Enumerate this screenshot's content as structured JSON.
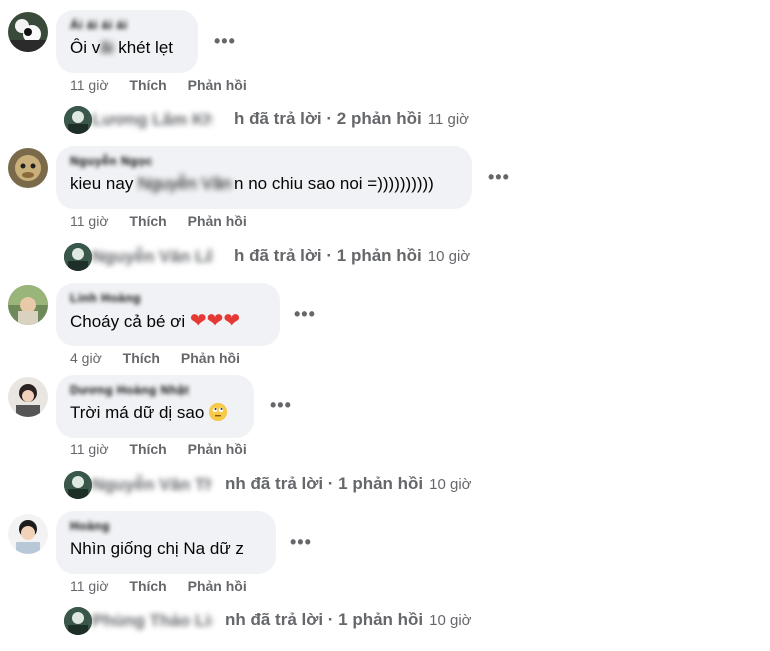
{
  "actions": {
    "like": "Thích",
    "reply": "Phản hồi"
  },
  "more_icon": "•••",
  "comments": [
    {
      "author": "Ái ái ái ái",
      "text_a": "Ôi v",
      "text_hidden": "ãi",
      "text_b": " khét lẹt",
      "time": "11 giờ",
      "reply_summary": {
        "name": "Lương Lâm Khánh",
        "suffix": "h đã trả lời · 2 phản hồi",
        "time": "11 giờ"
      }
    },
    {
      "author": "Nguyễn Ngọc",
      "text_a": "kieu nay ",
      "text_hidden": "Nguyễn Văn",
      "text_b": "n no chiu sao noi =))))))))))",
      "time": "11 giờ",
      "reply_summary": {
        "name": "Nguyễn Văn Lâm",
        "suffix": "h đã trả lời · 1 phản hồi",
        "time": "10 giờ"
      }
    },
    {
      "author": "Linh Hoàng",
      "text": "Choáy cả bé ơi",
      "hearts": "❤❤❤",
      "time": "4 giờ"
    },
    {
      "author": "Dương Hoàng Nhật",
      "text": "Trời má dữ dị sao",
      "emoji": "face-with-rolling-eyes",
      "time": "11 giờ",
      "reply_summary": {
        "name": "Nguyễn Văn Thanh",
        "suffix": "nh đã trả lời · 1 phản hồi",
        "time": "10 giờ"
      }
    },
    {
      "author": "Hoàng",
      "text": "Nhìn giống chị Na dữ z",
      "time": "11 giờ",
      "reply_summary": {
        "name": "Phùng Thảo Linh",
        "suffix": "nh đã trả lời · 1 phản hồi",
        "time": "10 giờ"
      }
    }
  ]
}
